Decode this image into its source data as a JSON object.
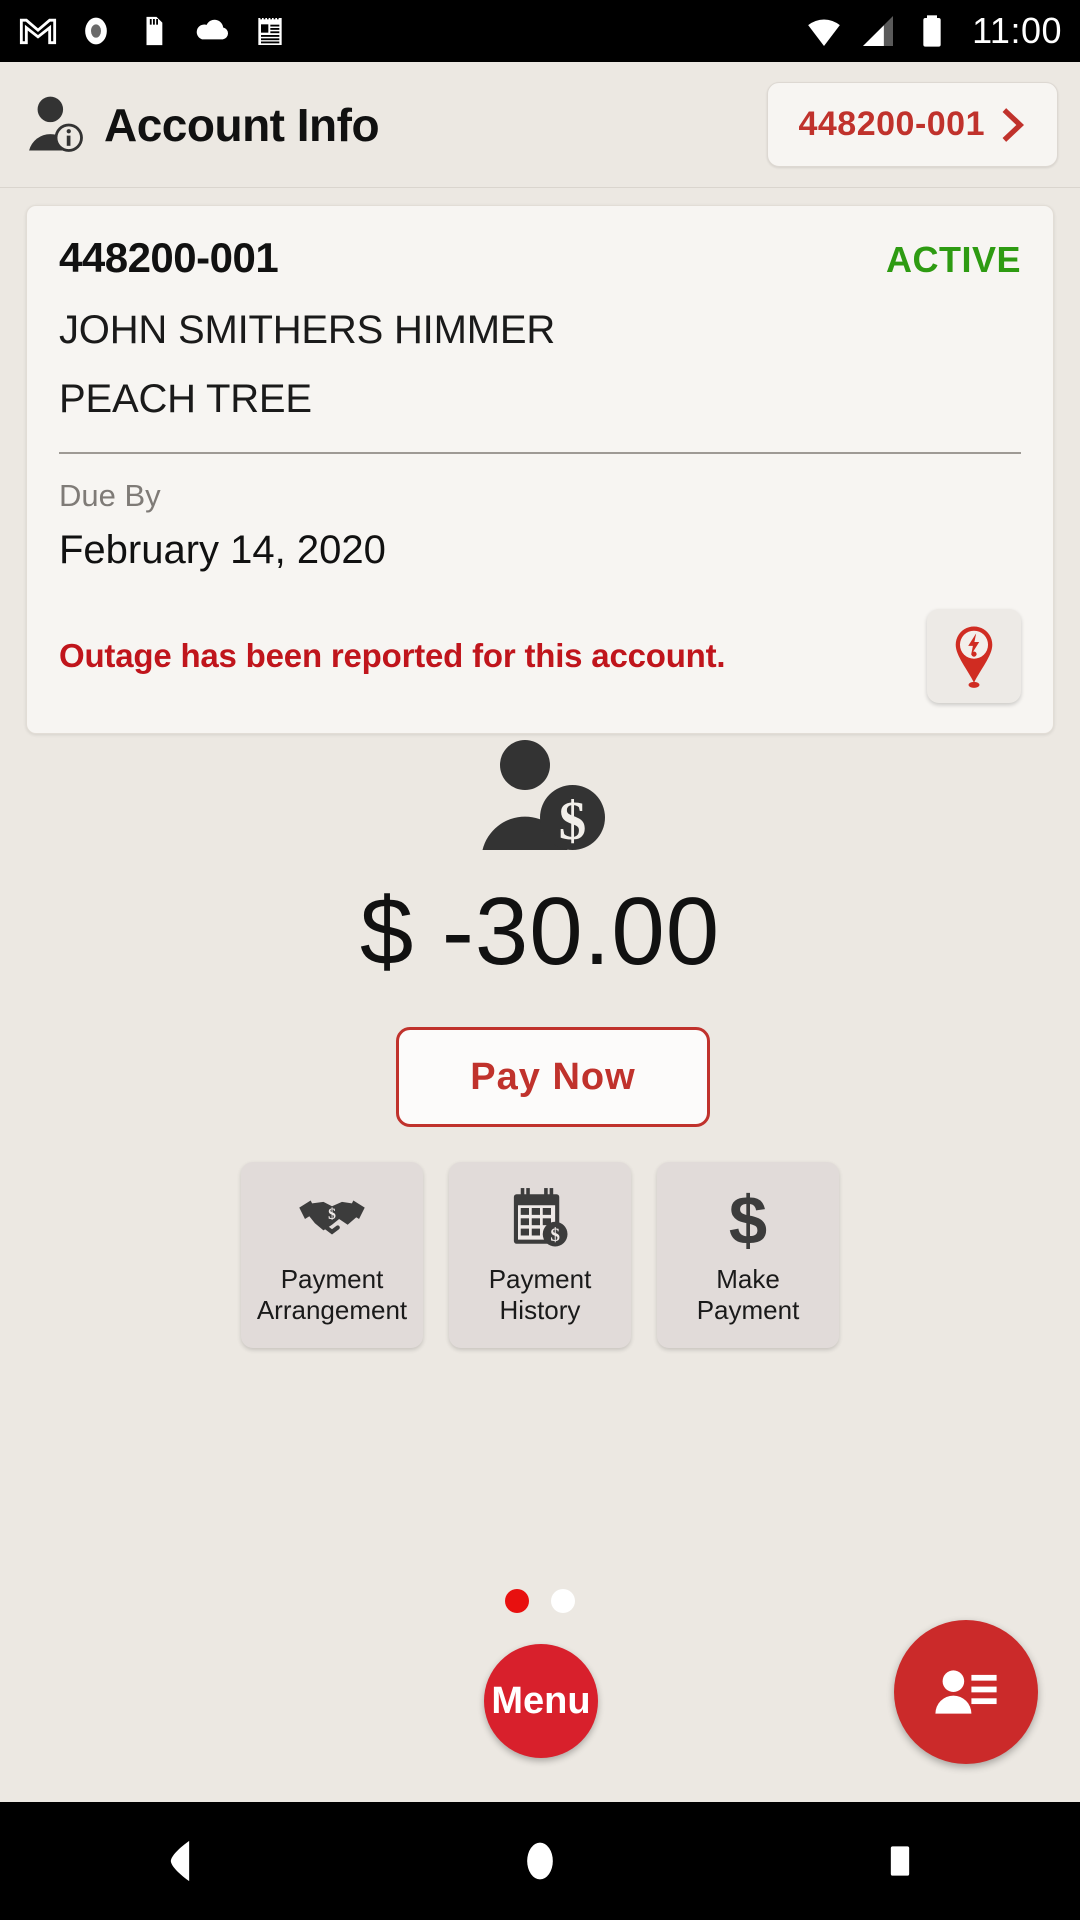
{
  "status_bar": {
    "time": "11:00",
    "left_icons": [
      "gmail-icon",
      "record-icon",
      "sd-card-icon",
      "cloud-icon",
      "notepad-icon"
    ],
    "right_icons": [
      "wifi-icon",
      "cellular-signal-icon",
      "battery-icon"
    ]
  },
  "header": {
    "avatar_icon": "person-info-icon",
    "title": "Account Info",
    "account_chip": {
      "label": "448200-001",
      "chevron_icon": "chevron-right-icon"
    }
  },
  "account_card": {
    "account_number": "448200-001",
    "status": "ACTIVE",
    "status_color": "#2E9B12",
    "customer_name": "JOHN SMITHERS HIMMER",
    "address": "PEACH TREE",
    "due_by_label": "Due By",
    "due_by_value": "February 14, 2020",
    "outage_message": "Outage has been reported for this account.",
    "outage_color": "#C0151C",
    "outage_icon": "outage-pin-icon"
  },
  "balance": {
    "icon": "person-dollar-icon",
    "amount": "$ -30.00",
    "pay_now_label": "Pay Now",
    "accent_color": "#C0322C"
  },
  "tiles": [
    {
      "icon": "handshake-dollar-icon",
      "line1": "Payment",
      "line2": "Arrangement"
    },
    {
      "icon": "calendar-dollar-icon",
      "line1": "Payment",
      "line2": "History"
    },
    {
      "icon": "dollar-sign-icon",
      "line1": "Make",
      "line2": "Payment"
    }
  ],
  "pager": {
    "dots": [
      {
        "state": "active",
        "color": "#E8100F"
      },
      {
        "state": "inactive",
        "color": "#FFFFFF"
      }
    ]
  },
  "fabs": {
    "menu_label": "Menu",
    "menu_color": "#D8202C",
    "contact_icon": "contact-card-icon",
    "contact_color": "#CB2A2A"
  },
  "nav_bar": {
    "back_icon": "back-triangle-icon",
    "home_icon": "home-circle-icon",
    "recents_icon": "recents-square-icon"
  }
}
